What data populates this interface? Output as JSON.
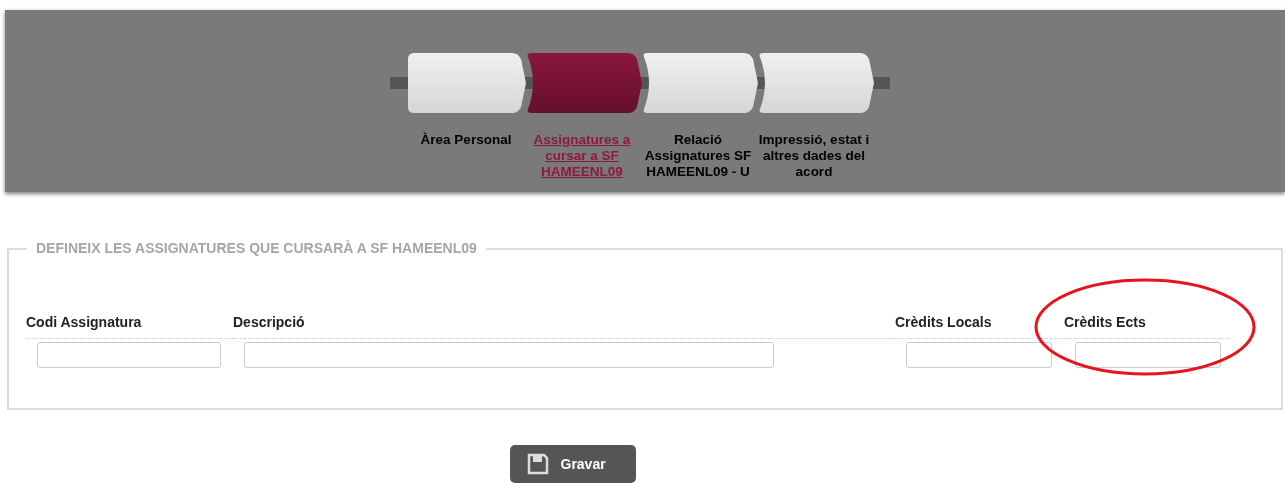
{
  "steps": [
    {
      "label": "Àrea Personal",
      "selected": false
    },
    {
      "label": "Assignatures a cursar a SF HAMEENL09",
      "selected": true
    },
    {
      "label": "Relació Assignatures SF HAMEENL09 - U",
      "selected": false
    },
    {
      "label": "Impressió, estat i altres dades del acord",
      "selected": false
    }
  ],
  "section": {
    "legend": "DEFINEIX LES ASSIGNATURES QUE CURSARÀ A SF HAMEENL09",
    "fields": [
      {
        "label": "Codi Assignatura"
      },
      {
        "label": "Descripció"
      },
      {
        "label": "Crèdits Locals"
      },
      {
        "label": "Crèdits Ects",
        "highlighted": true
      }
    ]
  },
  "save_button": {
    "label": "Gravar"
  }
}
